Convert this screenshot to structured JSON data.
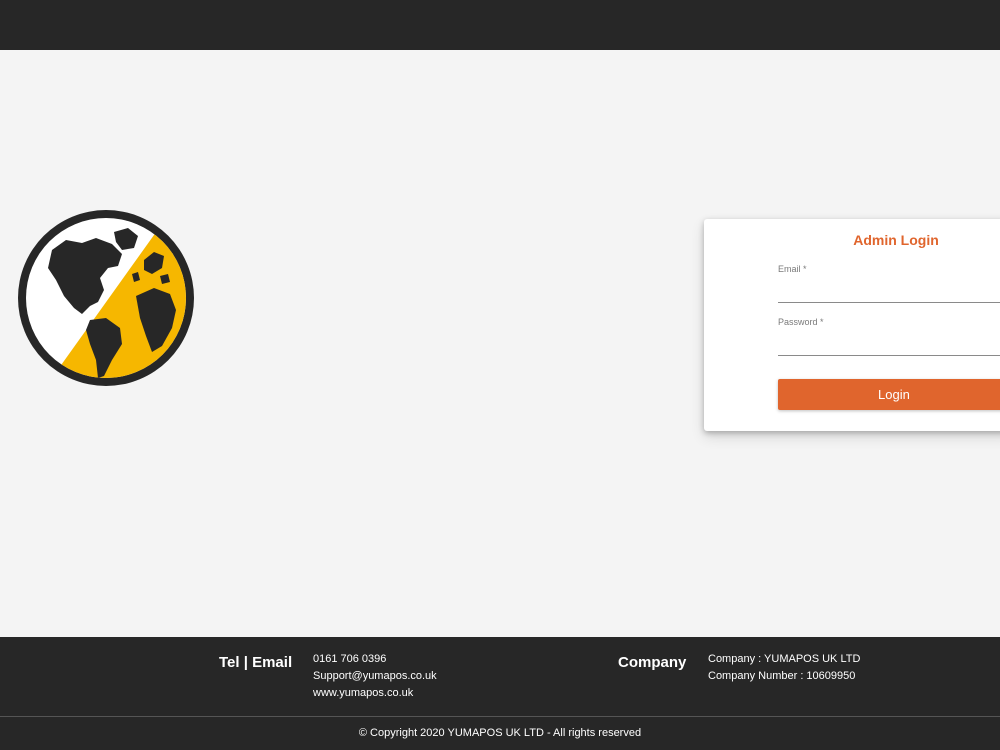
{
  "login": {
    "title": "Admin Login",
    "email_label": "Email *",
    "email_value": "",
    "password_label": "Password *",
    "password_value": "",
    "button_label": "Login"
  },
  "footer": {
    "contact_heading": "Tel | Email",
    "contact_lines": [
      "0161 706 0396",
      "Support@yumapos.co.uk",
      "www.yumapos.co.uk"
    ],
    "company_heading": "Company",
    "company_lines": [
      "Company : YUMAPOS UK LTD",
      "Company Number : 10609950"
    ],
    "copyright": "© Copyright 2020 YUMAPOS UK LTD - All rights reserved"
  },
  "colors": {
    "accent": "#e0652d",
    "dark": "#272727",
    "logo_yellow": "#f6b700"
  },
  "icons": {
    "logo": "globe-logo-icon",
    "password_toggle": "eye-icon"
  }
}
